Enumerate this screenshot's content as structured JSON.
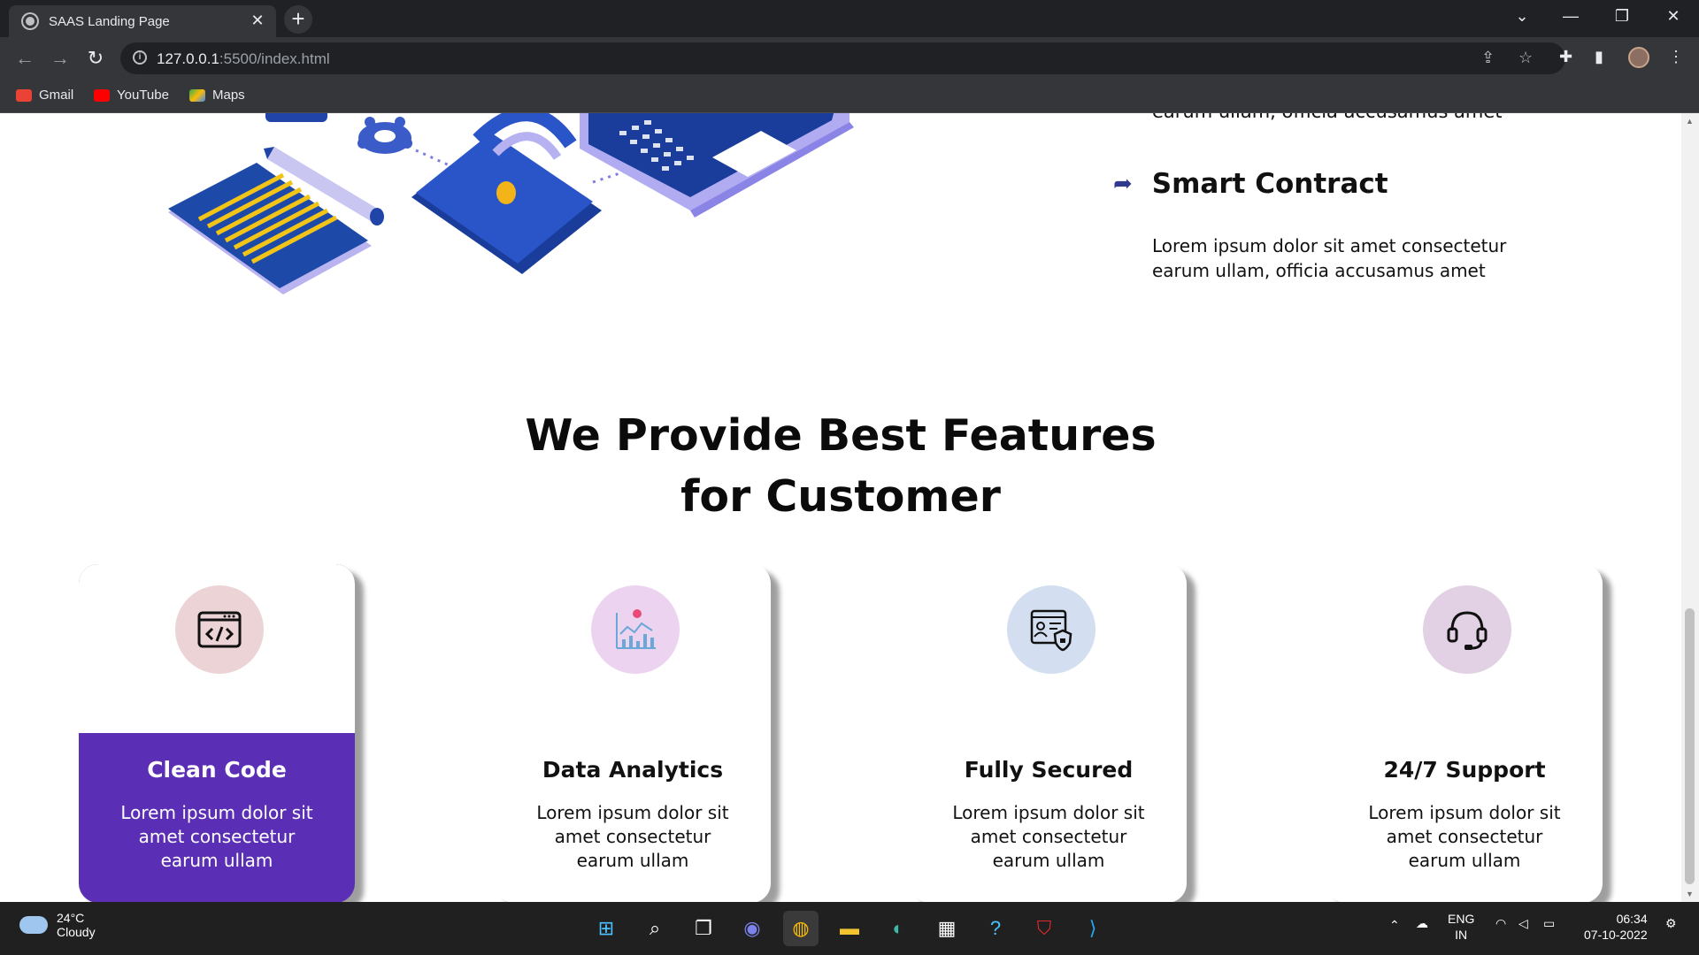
{
  "browser": {
    "tab_title": "SAAS Landing Page",
    "url_host": "127.0.0.1",
    "url_path": ":5500/index.html",
    "bookmarks": [
      {
        "label": "Gmail",
        "color": "#ea4335"
      },
      {
        "label": "YouTube",
        "color": "#ff0000"
      },
      {
        "label": "Maps",
        "color": "#34a853"
      }
    ]
  },
  "page": {
    "cut_text": "earum ullam, officia accusamus amet",
    "feature": {
      "title": "Smart Contract",
      "text": "Lorem ipsum dolor sit amet consectetur earum ullam, officia accusamus amet"
    },
    "section_title_line1": "We Provide Best Features",
    "section_title_line2": "for Customer",
    "cards": [
      {
        "title": "Clean Code",
        "text": "Lorem ipsum dolor sit amet consectetur earum ullam",
        "icon": "code-window-icon",
        "circle_color": "#ecd3d6",
        "active": true
      },
      {
        "title": "Data Analytics",
        "text": "Lorem ipsum dolor sit amet consectetur earum ullam",
        "icon": "analytics-chart-icon",
        "circle_color": "#ecd3ef",
        "active": false
      },
      {
        "title": "Fully Secured",
        "text": "Lorem ipsum dolor sit amet consectetur earum ullam",
        "icon": "security-shield-icon",
        "circle_color": "#d3dff0",
        "active": false
      },
      {
        "title": "24/7 Support",
        "text": "Lorem ipsum dolor sit amet consectetur earum ullam",
        "icon": "headset-icon",
        "circle_color": "#e2d0e4",
        "active": false
      }
    ],
    "accent_color": "#5b2fb5"
  },
  "taskbar": {
    "weather_temp": "24°C",
    "weather_desc": "Cloudy",
    "lang_line1": "ENG",
    "lang_line2": "IN",
    "time": "06:34",
    "date": "07-10-2022"
  }
}
